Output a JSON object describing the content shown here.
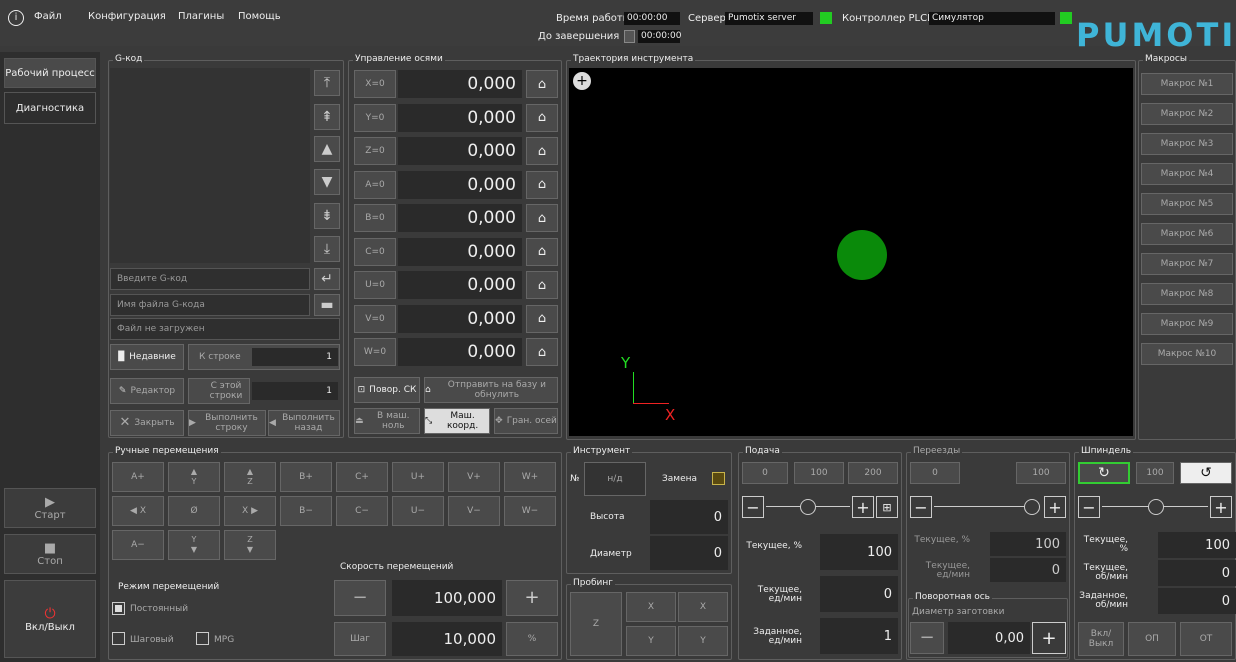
{
  "menu": {
    "info_icon": "info-icon",
    "file": "Файл",
    "config": "Конфигурация",
    "plugins": "Плагины",
    "help": "Помощь"
  },
  "status": {
    "work_time_label": "Время работы",
    "work_time": "00:00:00",
    "remaining_label": "До завершения",
    "remaining": "00:00:00",
    "server_label": "Сервер",
    "server": "Pumotix server",
    "plc_label": "Контроллер PLCM",
    "plc": "Симулятор",
    "led_color": "#22cc22",
    "logo": "PUMOTIX",
    "logo_color": "#3fb5d8"
  },
  "nav": {
    "workflow": "Рабочий процесс",
    "diagnostics": "Диагностика",
    "start": "Старт",
    "stop": "Стоп",
    "power": "Вкл/Выкл"
  },
  "gcode": {
    "title": "G-код",
    "input_placeholder": "Введите G-код",
    "file_placeholder": "Имя файла G-кода",
    "status": "Файл не загружен",
    "recent": "Недавние",
    "to_line": "К строке",
    "to_line_value": "1",
    "editor": "Редактор",
    "from_line": "С этой строки",
    "from_line_value": "1",
    "close": "Закрыть",
    "run_line": "Выполнить строку",
    "run_back": "Выполнить назад"
  },
  "axes": {
    "title": "Управление осями",
    "rows": [
      {
        "btn": "X=0",
        "value": "0,000"
      },
      {
        "btn": "Y=0",
        "value": "0,000"
      },
      {
        "btn": "Z=0",
        "value": "0,000"
      },
      {
        "btn": "A=0",
        "value": "0,000"
      },
      {
        "btn": "B=0",
        "value": "0,000"
      },
      {
        "btn": "C=0",
        "value": "0,000"
      },
      {
        "btn": "U=0",
        "value": "0,000"
      },
      {
        "btn": "V=0",
        "value": "0,000"
      },
      {
        "btn": "W=0",
        "value": "0,000"
      }
    ],
    "rot_cs": "Повор. СК",
    "send_base": "Отправить на базу и обнулить",
    "to_machine_zero": "В маш. ноль",
    "machine_coords": "Маш. коорд.",
    "axis_limits": "Гран. осей"
  },
  "trajectory": {
    "title": "Траектория инструмента",
    "y_axis": "Y",
    "x_axis": "X",
    "axis_y_color": "#22dd22",
    "axis_x_color": "#ee2222",
    "dot_color": "#0a8a0a"
  },
  "macros": {
    "title": "Макросы",
    "items": [
      "Макрос №1",
      "Макрос №2",
      "Макрос №3",
      "Макрос №4",
      "Макрос №5",
      "Макрос №6",
      "Макрос №7",
      "Макрос №8",
      "Макрос №9",
      "Макрос №10"
    ]
  },
  "jog": {
    "title": "Ручные перемещения",
    "row1": [
      "A+",
      "",
      "",
      "B+",
      "C+",
      "U+",
      "V+",
      "W+"
    ],
    "row2": [
      "",
      "Ø",
      "",
      "B−",
      "C−",
      "U−",
      "V−",
      "W−"
    ],
    "row3": [
      "A−",
      "",
      ""
    ],
    "row1_icons": [
      "",
      "Y",
      "Z"
    ],
    "row2_icons": [
      "X",
      "",
      "X"
    ],
    "row3_icons": [
      "",
      "Y",
      "Z"
    ],
    "mode_title": "Режим перемещений",
    "constant": "Постоянный",
    "step": "Шаговый",
    "mpg": "MPG",
    "speed_title": "Скорость перемещений",
    "speed": "100,000",
    "step_label": "Шаг",
    "step_value": "10,000",
    "percent": "%"
  },
  "tool": {
    "title": "Инструмент",
    "no_label": "№",
    "no_value": "н/д",
    "change": "Замена",
    "height_label": "Высота",
    "height": "0",
    "diameter_label": "Диаметр",
    "diameter": "0"
  },
  "probing": {
    "title": "Пробинг",
    "z": "Z",
    "x1": "X",
    "x2": "X",
    "y1": "Y",
    "y2": "Y"
  },
  "feed": {
    "title": "Подача",
    "p0": "0",
    "p100": "100",
    "p200": "200",
    "current_pct_label": "Текущее, %",
    "current_pct": "100",
    "current_units_label": "Текущее, ед/мин",
    "current_units": "0",
    "set_label": "Заданное, ед/мин",
    "set": "1"
  },
  "rapid": {
    "title": "Переезды",
    "p0": "0",
    "p100": "100",
    "current_pct_label": "Текущее, %",
    "current_pct": "100",
    "current_units_label": "Текущее, ед/мин",
    "current_units": "0",
    "rotary_title": "Поворотная ось",
    "diameter_label": "Диаметр заготовки",
    "diameter": "0,00"
  },
  "spindle": {
    "title": "Шпиндель",
    "p100": "100",
    "current_pct_label": "Текущее, %",
    "current_pct": "100",
    "current_rpm_label": "Текущее, об/мин",
    "current_rpm": "0",
    "set_label": "Заданное, об/мин",
    "set": "0",
    "onoff": "Вкл/ Выкл",
    "op": "ОП",
    "ot": "ОТ",
    "accent": "#33cc33"
  }
}
